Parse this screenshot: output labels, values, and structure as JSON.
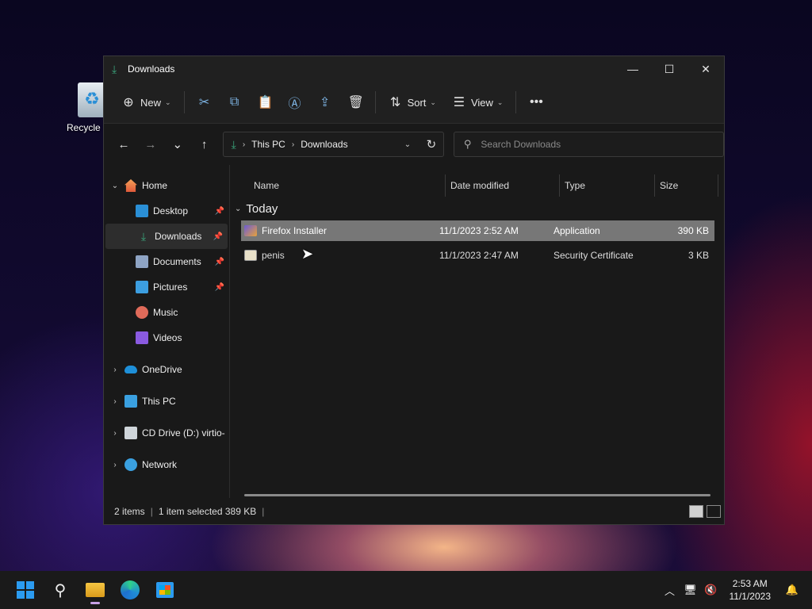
{
  "desktop": {
    "recycle_label": "Recycle"
  },
  "window": {
    "title": "Downloads",
    "controls": {
      "minimize": "—",
      "maximize": "☐",
      "close": "✕"
    }
  },
  "toolbar": {
    "new_label": "New",
    "sort_label": "Sort",
    "view_label": "View",
    "more": "•••"
  },
  "nav": {
    "address": [
      "This PC",
      "Downloads"
    ],
    "search_placeholder": "Search Downloads"
  },
  "sidebar": {
    "home": "Home",
    "pinned": [
      {
        "label": "Desktop"
      },
      {
        "label": "Downloads"
      },
      {
        "label": "Documents"
      },
      {
        "label": "Pictures"
      },
      {
        "label": "Music"
      },
      {
        "label": "Videos"
      }
    ],
    "onedrive": "OneDrive",
    "thispc": "This PC",
    "cddrive": "CD Drive (D:) virtio-",
    "network": "Network"
  },
  "columns": {
    "name": "Name",
    "date": "Date modified",
    "type": "Type",
    "size": "Size"
  },
  "group": "Today",
  "files": [
    {
      "name": "Firefox Installer",
      "date": "11/1/2023 2:52 AM",
      "type": "Application",
      "size": "390 KB"
    },
    {
      "name": "penis",
      "date": "11/1/2023 2:47 AM",
      "type": "Security Certificate",
      "size": "3 KB"
    }
  ],
  "status": {
    "count": "2 items",
    "selection": "1 item selected  389 KB"
  },
  "taskbar": {
    "time": "2:53 AM",
    "date": "11/1/2023"
  }
}
